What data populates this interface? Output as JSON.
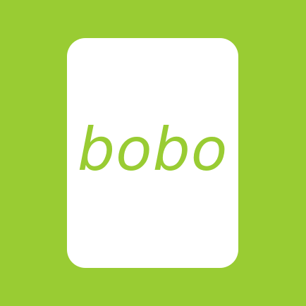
{
  "app_icon": {
    "logo_text": "bobo",
    "background_color": "#99cc33",
    "card_color": "#ffffff",
    "logo_color": "#99cc33"
  }
}
